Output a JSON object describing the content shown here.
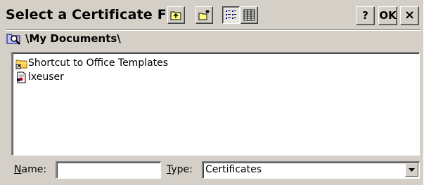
{
  "dialog": {
    "title": "Select a Certificate File",
    "toolbar": {
      "up_icon": "folder-up-icon",
      "new_folder_icon": "new-folder-icon",
      "list_view_icon": "list-view-icon",
      "details_view_icon": "details-view-icon"
    },
    "help_label": "?",
    "ok_label": "OK",
    "close_label": "×"
  },
  "path": {
    "icon": "folder-search-icon",
    "text": "\\My Documents\\"
  },
  "files": [
    {
      "name": "Shortcut to Office Templates",
      "icon": "folder-shortcut-icon"
    },
    {
      "name": "lxeuser",
      "icon": "certificate-file-icon"
    }
  ],
  "name_field": {
    "label_prefix": "N",
    "label_rest": "ame:",
    "value": ""
  },
  "type_field": {
    "label_prefix": "T",
    "label_rest": "ype:",
    "value": "Certificates"
  },
  "colors": {
    "face": "#d4d0c8",
    "shadow": "#808080",
    "highlight": "#ffffff"
  }
}
